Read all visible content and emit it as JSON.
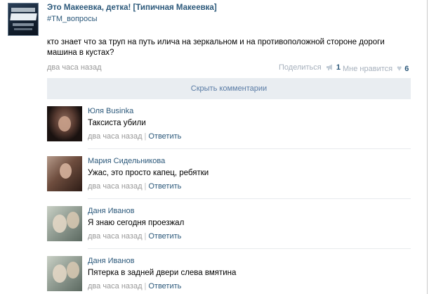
{
  "post": {
    "group_name": "Это Макеевка, детка! [Типичная Макеевка]",
    "hashtag": "#TM_вопросы",
    "text": "кто знает что за труп на путь илича на зеркальном и на противоположной стороне дороги машина в кустах?",
    "time": "два часа назад",
    "share_label": "Поделиться",
    "share_count": "1",
    "like_label": "Мне нравится",
    "like_count": "6"
  },
  "hide_comments_label": "Скрыть комментарии",
  "comments": [
    {
      "author": "Юля Businka",
      "text": "Таксиста убили",
      "time": "два часа назад",
      "sep": "|",
      "reply_label": "Ответить"
    },
    {
      "author": "Мария Сидельникова",
      "text": "Ужас, это просто капец, ребятки",
      "time": "два часа назад",
      "sep": "|",
      "reply_label": "Ответить"
    },
    {
      "author": "Даня Иванов",
      "text": "Я знаю сегодня проезжал",
      "time": "два часа назад",
      "sep": "|",
      "reply_label": "Ответить"
    },
    {
      "author": "Даня Иванов",
      "text": "Пятерка в задней двери слева вмятина",
      "time": "два часа назад",
      "sep": "|",
      "reply_label": "Ответить"
    }
  ],
  "colors": {
    "link": "#2b587a",
    "meta": "#999999",
    "bar": "#e9edf1"
  }
}
